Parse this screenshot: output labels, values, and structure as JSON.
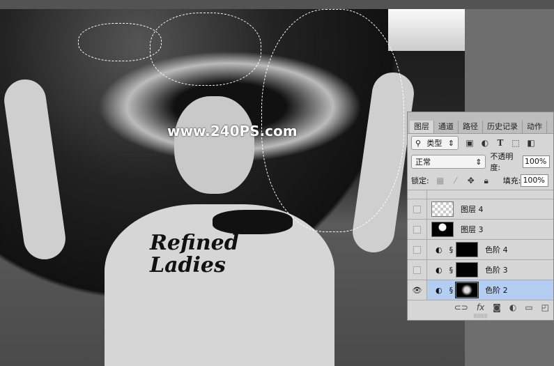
{
  "watermark": "www.240PS.com",
  "shirt_text": [
    "Refined",
    "Ladies"
  ],
  "panel": {
    "tabs": [
      "图层",
      "通道",
      "路径",
      "历史记录",
      "动作"
    ],
    "filter": {
      "label": "类型"
    },
    "blend_mode": "正常",
    "opacity_label": "不透明度:",
    "opacity": "100%",
    "lock_label": "锁定:",
    "fill_label": "填充:",
    "fill": "100%",
    "layers": [
      {
        "name": "图层 4",
        "visible": false,
        "type": "pixel"
      },
      {
        "name": "图层 3",
        "visible": false,
        "type": "pixel"
      },
      {
        "name": "色阶 4",
        "visible": false,
        "type": "adjustment"
      },
      {
        "name": "色阶 3",
        "visible": false,
        "type": "adjustment"
      },
      {
        "name": "色阶 2",
        "visible": true,
        "type": "adjustment",
        "selected": true
      }
    ]
  }
}
